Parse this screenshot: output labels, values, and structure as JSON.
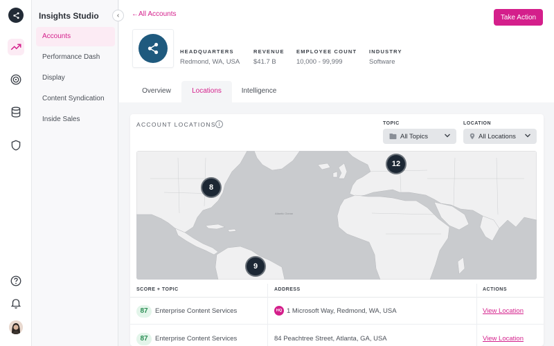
{
  "colors": {
    "accent": "#d41f8b",
    "score_bg": "#e3f5ea",
    "score_text": "#2a8d53",
    "pin": "#1c2734"
  },
  "rail": {
    "icons": [
      "logo-share-icon",
      "trending-up-icon",
      "target-icon",
      "database-icon",
      "shield-icon",
      "help-icon",
      "bell-icon"
    ]
  },
  "nav": {
    "studio": "Insights Studio",
    "items": [
      {
        "label": "Accounts",
        "active": true
      },
      {
        "label": "Performance Dash"
      },
      {
        "label": "Display"
      },
      {
        "label": "Content Syndication"
      },
      {
        "label": "Inside Sales"
      }
    ]
  },
  "header": {
    "back_label": "All Accounts",
    "action_label": "Take Action",
    "meta": [
      {
        "label": "Headquarters",
        "value": "Redmond, WA, USA"
      },
      {
        "label": "Revenue",
        "value": "$41.7 B"
      },
      {
        "label": "Employee Count",
        "value": "10,000 - 99,999"
      },
      {
        "label": "Industry",
        "value": "Software"
      }
    ],
    "tabs": [
      {
        "label": "Overview"
      },
      {
        "label": "Locations",
        "active": true
      },
      {
        "label": "Intelligence"
      }
    ]
  },
  "locations": {
    "title": "Account Locations",
    "info_glyph": "i",
    "topic": {
      "label": "TOPIC",
      "value": "All Topics"
    },
    "location": {
      "label": "LOCATION",
      "value": "All Locations"
    },
    "map": {
      "ocean_label": "Atlantic Ocean",
      "clusters": [
        {
          "count": "8"
        },
        {
          "count": "12"
        },
        {
          "count": "9"
        }
      ]
    },
    "table": {
      "headers": {
        "score": "SCORE + TOPIC",
        "address": "ADDRESS",
        "actions": "ACTIONS"
      },
      "rows": [
        {
          "score": "87",
          "topic": "Enterprise Content Services",
          "hq_badge": "HQ",
          "address": "1 Microsoft Way, Redmond, WA, USA",
          "action": "View Location"
        },
        {
          "score": "87",
          "topic": "Enterprise Content Services",
          "hq_badge": "",
          "address": "84 Peachtree Street, Atlanta, GA, USA",
          "action": "View Location"
        }
      ]
    }
  }
}
